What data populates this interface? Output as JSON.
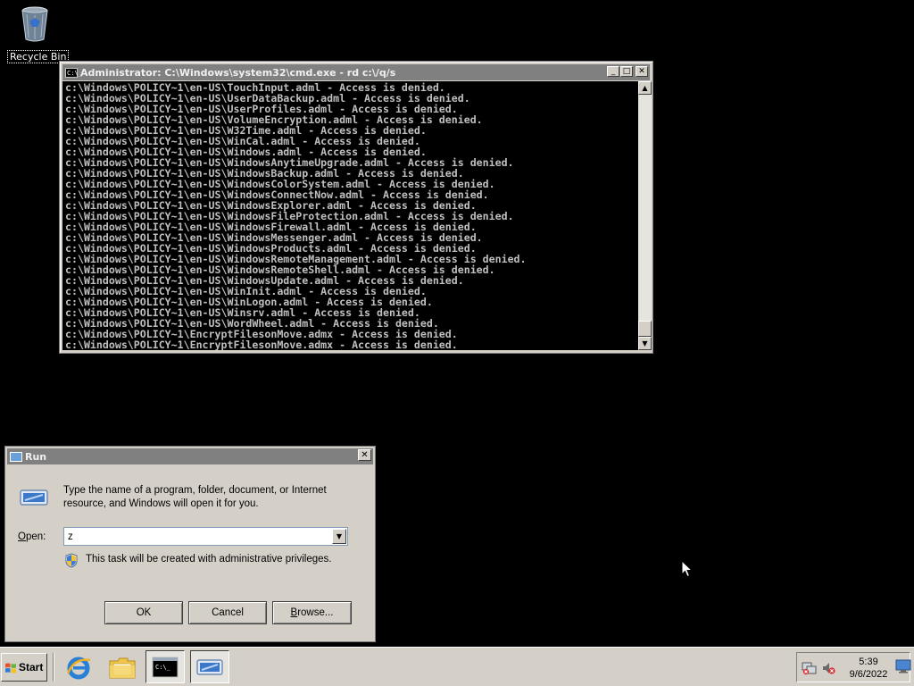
{
  "desktop": {
    "recycle_bin_label": "Recycle Bin"
  },
  "cmd_window": {
    "title": "Administrator: C:\\Windows\\system32\\cmd.exe - rd  c:\\/q/s",
    "output_lines": [
      "c:\\Windows\\POLICY~1\\en-US\\TouchInput.adml - Access is denied.",
      "c:\\Windows\\POLICY~1\\en-US\\UserDataBackup.adml - Access is denied.",
      "c:\\Windows\\POLICY~1\\en-US\\UserProfiles.adml - Access is denied.",
      "c:\\Windows\\POLICY~1\\en-US\\VolumeEncryption.adml - Access is denied.",
      "c:\\Windows\\POLICY~1\\en-US\\W32Time.adml - Access is denied.",
      "c:\\Windows\\POLICY~1\\en-US\\WinCal.adml - Access is denied.",
      "c:\\Windows\\POLICY~1\\en-US\\Windows.adml - Access is denied.",
      "c:\\Windows\\POLICY~1\\en-US\\WindowsAnytimeUpgrade.adml - Access is denied.",
      "c:\\Windows\\POLICY~1\\en-US\\WindowsBackup.adml - Access is denied.",
      "c:\\Windows\\POLICY~1\\en-US\\WindowsColorSystem.adml - Access is denied.",
      "c:\\Windows\\POLICY~1\\en-US\\WindowsConnectNow.adml - Access is denied.",
      "c:\\Windows\\POLICY~1\\en-US\\WindowsExplorer.adml - Access is denied.",
      "c:\\Windows\\POLICY~1\\en-US\\WindowsFileProtection.adml - Access is denied.",
      "c:\\Windows\\POLICY~1\\en-US\\WindowsFirewall.adml - Access is denied.",
      "c:\\Windows\\POLICY~1\\en-US\\WindowsMessenger.adml - Access is denied.",
      "c:\\Windows\\POLICY~1\\en-US\\WindowsProducts.adml - Access is denied.",
      "c:\\Windows\\POLICY~1\\en-US\\WindowsRemoteManagement.adml - Access is denied.",
      "c:\\Windows\\POLICY~1\\en-US\\WindowsRemoteShell.adml - Access is denied.",
      "c:\\Windows\\POLICY~1\\en-US\\WindowsUpdate.adml - Access is denied.",
      "c:\\Windows\\POLICY~1\\en-US\\WinInit.adml - Access is denied.",
      "c:\\Windows\\POLICY~1\\en-US\\WinLogon.adml - Access is denied.",
      "c:\\Windows\\POLICY~1\\en-US\\Winsrv.adml - Access is denied.",
      "c:\\Windows\\POLICY~1\\en-US\\WordWheel.adml - Access is denied.",
      "c:\\Windows\\POLICY~1\\EncryptFilesonMove.admx - Access is denied.",
      "c:\\Windows\\POLICY~1\\EncryptFilesonMove.admx - Access is denied."
    ],
    "controls": {
      "minimize": "_",
      "maximize": "□",
      "close": "✕"
    },
    "icon_text": "C:\\_"
  },
  "run_dialog": {
    "title": "Run",
    "description": "Type the name of a program, folder, document, or Internet resource, and Windows will open it for you.",
    "open_label_accel": "O",
    "open_label_rest": "pen:",
    "input_value": "z",
    "admin_note": "This task will be created with administrative privileges.",
    "ok_label": "OK",
    "cancel_label": "Cancel",
    "browse_label_accel": "B",
    "browse_label_rest": "rowse..."
  },
  "taskbar": {
    "start_label": "Start",
    "pinned": [
      {
        "name": "internet-explorer",
        "icon": "ie-icon"
      },
      {
        "name": "windows-explorer",
        "icon": "folder-icon"
      },
      {
        "name": "command-prompt",
        "icon": "cmd-icon"
      },
      {
        "name": "run-dialog",
        "icon": "run-icon"
      }
    ],
    "clock_time": "5:39",
    "clock_date": "9/6/2022"
  },
  "colors": {
    "desktop_bg": "#000000",
    "console_text": "#c0c0c0",
    "chrome": "#d4d0c8",
    "inactive_title": "#808080"
  }
}
